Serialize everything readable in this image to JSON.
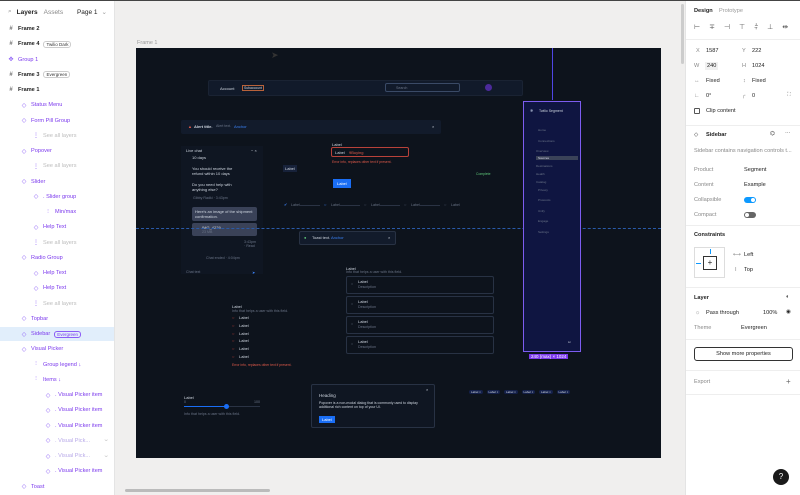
{
  "left_panel": {
    "tabs": [
      "Layers",
      "Assets"
    ],
    "page": "Page 1",
    "layers": [
      {
        "label": "Frame 2",
        "level": 0,
        "kind": "frame"
      },
      {
        "label": "Frame 4",
        "level": 0,
        "kind": "frame",
        "badge": "Twilio Dark"
      },
      {
        "label": "Group 1",
        "level": 0,
        "kind": "group"
      },
      {
        "label": "Frame 3",
        "level": 0,
        "kind": "frame",
        "badge": "Evergreen"
      },
      {
        "label": "Frame 1",
        "level": 0,
        "kind": "frame"
      },
      {
        "label": "Status Menu",
        "level": 1,
        "kind": "instance"
      },
      {
        "label": "Form Pill Group",
        "level": 1,
        "kind": "instance"
      },
      {
        "label": "See all layers",
        "level": 2,
        "kind": "see"
      },
      {
        "label": "Popover",
        "level": 1,
        "kind": "instance"
      },
      {
        "label": "See all layers",
        "level": 2,
        "kind": "see"
      },
      {
        "label": "Slider",
        "level": 1,
        "kind": "instance"
      },
      {
        "label": ". Slider group",
        "level": 2,
        "kind": "instance"
      },
      {
        "label": "Min/max",
        "level": 3,
        "kind": "auto"
      },
      {
        "label": "Help Text",
        "level": 2,
        "kind": "instance"
      },
      {
        "label": "See all layers",
        "level": 2,
        "kind": "see"
      },
      {
        "label": "Radio Group",
        "level": 1,
        "kind": "instance"
      },
      {
        "label": "Help Text",
        "level": 2,
        "kind": "instance"
      },
      {
        "label": "Help Text",
        "level": 2,
        "kind": "instance"
      },
      {
        "label": "See all layers",
        "level": 2,
        "kind": "see"
      },
      {
        "label": "Topbar",
        "level": 1,
        "kind": "instance"
      },
      {
        "label": "Sidebar",
        "level": 1,
        "kind": "instance",
        "badge": "Evergreen",
        "selected": true
      },
      {
        "label": "Visual Picker",
        "level": 1,
        "kind": "instance"
      },
      {
        "label": "Group legend ↓",
        "level": 2,
        "kind": "auto"
      },
      {
        "label": "Items ↓",
        "level": 2,
        "kind": "auto"
      },
      {
        "label": ". Visual Picker item",
        "level": 3,
        "kind": "instance"
      },
      {
        "label": ". Visual Picker item",
        "level": 3,
        "kind": "instance"
      },
      {
        "label": ". Visual Picker item",
        "level": 3,
        "kind": "instance"
      },
      {
        "label": ". Visual Pick...",
        "level": 3,
        "kind": "instance",
        "hidden": true
      },
      {
        "label": ". Visual Pick...",
        "level": 3,
        "kind": "instance",
        "hidden": true
      },
      {
        "label": ". Visual Picker item",
        "level": 3,
        "kind": "instance"
      },
      {
        "label": "Toast",
        "level": 1,
        "kind": "instance"
      }
    ]
  },
  "canvas": {
    "frame_label": "Frame 1",
    "topbar": {
      "account": "Account",
      "badge": "Subaccount",
      "search_placeholder": "Search"
    },
    "alert": {
      "title": "Alert title.",
      "text": "Alert text.",
      "link": "Anchor"
    },
    "chat": {
      "title": "Live chat",
      "m1": "10 days",
      "m2": "You should receive the refund within 10 days",
      "m3": "Do you need help with anything else?",
      "meta": "Gibby Radki · 3:43pm",
      "m4": "Here's an image of the shipment confirmation.",
      "file": "IMG_4229",
      "size": "23 MB",
      "read": "3:43pm · Read",
      "ended": "Chat ended · 4:04pm",
      "input": "Chat text"
    },
    "form": {
      "label": "Label",
      "prefix": "Label",
      "value": "9Buying",
      "error": "Error info, replaces other text if present."
    },
    "pill": "Label",
    "button": "Label",
    "status": "Complete",
    "stepper": [
      "Label",
      "Label",
      "Label",
      "Label",
      "Label"
    ],
    "toast": {
      "text": "Toast text.",
      "link": "Anchor"
    },
    "visual_picker": {
      "label": "Label",
      "help": "Info that helps a user with this field.",
      "items": [
        {
          "label": "Label",
          "desc": "Description"
        },
        {
          "label": "Label",
          "desc": "Description"
        },
        {
          "label": "Label",
          "desc": "Description"
        },
        {
          "label": "Label",
          "desc": "Description"
        }
      ]
    },
    "radio": {
      "label": "Label",
      "help": "Info that helps a user with this field.",
      "items": [
        "Label",
        "Label",
        "Label",
        "Label",
        "Label",
        "Label"
      ],
      "error": "Error info, replaces other text if present."
    },
    "slider": {
      "label": "Label",
      "min": "0",
      "max": "100",
      "help": "Info that helps a user with this field.",
      "value_pct": 55
    },
    "popover": {
      "heading": "Heading",
      "body": "Popover is a non-modal dialog that is commonly used to display additional rich content on top of your UI.",
      "button": "Label"
    },
    "form_pills": [
      "Label",
      "Label",
      "Label",
      "Label",
      "Label",
      "Label"
    ],
    "sidebar": {
      "title": "Twilio Segment",
      "items": [
        "Home",
        "Connections",
        "Overview",
        "Sources",
        "Destinations",
        "Health",
        "Catalog",
        "Privacy",
        "Protocols",
        "Unify",
        "Engage",
        "Settings"
      ],
      "active": "Sources",
      "size_label": "240 (max) × 1024"
    }
  },
  "right_panel": {
    "tabs": [
      "Design",
      "Prototype"
    ],
    "x": "1587",
    "y": "222",
    "w": "240",
    "h": "1024",
    "w_label": "W",
    "h_label": "H",
    "x_label": "X",
    "y_label": "Y",
    "hsize": "Fixed",
    "vsize": "Fixed",
    "rotation": "0°",
    "radius": "0",
    "clip": "Clip content",
    "component": "Sidebar",
    "description": "Sidebar contains navigation controls t...",
    "props": [
      {
        "name": "Product",
        "value": "Segment"
      },
      {
        "name": "Content",
        "value": "Example"
      },
      {
        "name": "Collapsible",
        "value": "on"
      },
      {
        "name": "Compact",
        "value": "off"
      }
    ],
    "constraints_title": "Constraints",
    "h_constraint": "Left",
    "v_constraint": "Top",
    "layer_title": "Layer",
    "blend": "Pass through",
    "opacity": "100%",
    "theme_label": "Theme",
    "theme": "Evergreen",
    "show_more": "Show more properties",
    "export": "Export",
    "accent": "#0d99ff"
  }
}
